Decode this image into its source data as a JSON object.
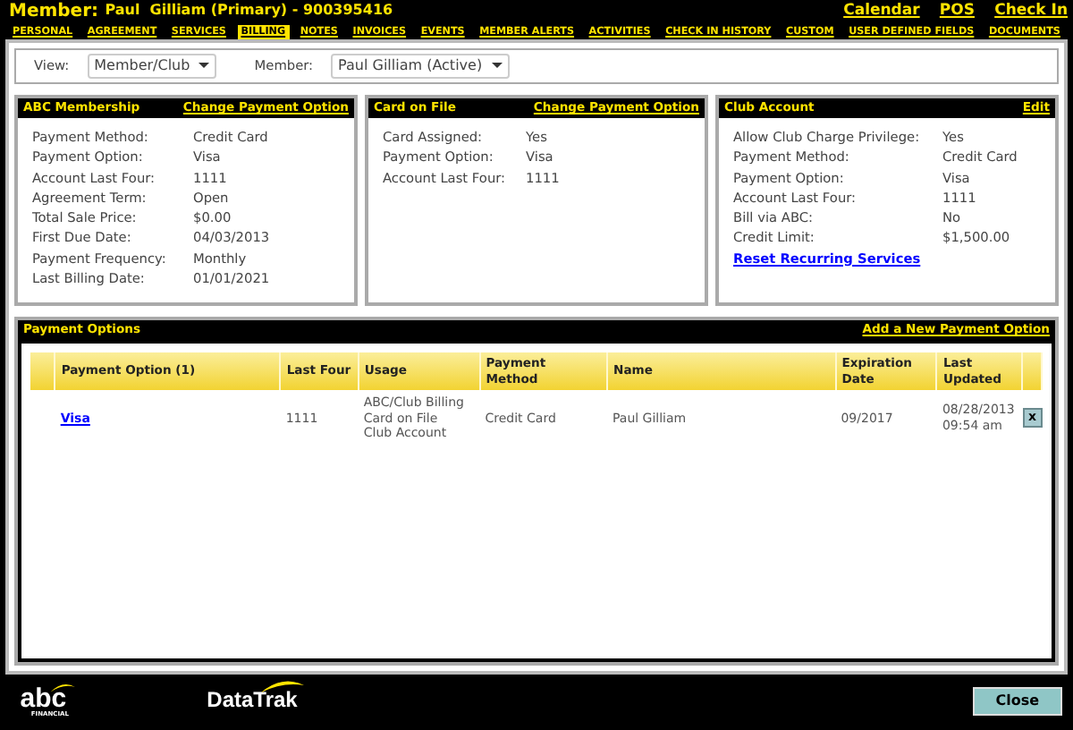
{
  "header": {
    "label": "Member:",
    "member": "Paul  Gilliam (Primary) - 900395416",
    "links": [
      "Calendar",
      "POS",
      "Check In"
    ]
  },
  "tabs": [
    {
      "label": "PERSONAL",
      "selected": false
    },
    {
      "label": "AGREEMENT",
      "selected": false
    },
    {
      "label": "SERVICES",
      "selected": false
    },
    {
      "label": "BILLING",
      "selected": true
    },
    {
      "label": "NOTES",
      "selected": false
    },
    {
      "label": "INVOICES",
      "selected": false
    },
    {
      "label": "EVENTS",
      "selected": false
    },
    {
      "label": "MEMBER ALERTS",
      "selected": false
    },
    {
      "label": "ACTIVITIES",
      "selected": false
    },
    {
      "label": "CHECK IN HISTORY",
      "selected": false
    },
    {
      "label": "CUSTOM",
      "selected": false
    },
    {
      "label": "USER DEFINED FIELDS",
      "selected": false
    },
    {
      "label": "DOCUMENTS",
      "selected": false
    }
  ],
  "filters": [
    {
      "label": "View:",
      "value": "Member/Club"
    },
    {
      "label": "Member:",
      "value": "Paul Gilliam (Active)"
    }
  ],
  "panels": [
    {
      "title": "ABC Membership",
      "action": "Change Payment Option",
      "rows": [
        [
          "Payment Method:",
          "Credit Card"
        ],
        [
          "Payment Option:",
          "Visa"
        ],
        [
          "Account Last Four:",
          "1111"
        ],
        [
          "Agreement Term:",
          "Open"
        ],
        [
          "Total Sale Price:",
          "$0.00"
        ],
        [
          "First Due Date:",
          "04/03/2013"
        ],
        [
          "Payment Frequency:",
          "Monthly"
        ],
        [
          "Last Billing Date:",
          "01/01/2021"
        ]
      ]
    },
    {
      "title": "Card on File",
      "action": "Change Payment Option",
      "rows": [
        [
          "Card Assigned:",
          "Yes"
        ],
        [
          "Payment Option:",
          "Visa"
        ],
        [
          "Account Last Four:",
          "1111"
        ]
      ]
    },
    {
      "title": "Club Account",
      "action": "Edit",
      "rows": [
        [
          "Allow Club Charge Privilege:",
          "Yes"
        ],
        [
          "Payment Method:",
          "Credit Card"
        ],
        [
          "Payment Option:",
          "Visa"
        ],
        [
          "Account Last Four:",
          "1111"
        ],
        [
          "Bill via ABC:",
          "No"
        ],
        [
          "Credit Limit:",
          "$1,500.00"
        ]
      ],
      "link": "Reset Recurring Services"
    }
  ],
  "payment_options": {
    "title": "Payment Options",
    "action": "Add a New Payment Option",
    "columns": [
      "Payment Option (1)",
      "Last Four",
      "Usage",
      "Payment Method",
      "Name",
      "Expiration Date",
      "Last Updated"
    ],
    "rows": [
      {
        "option": "Visa",
        "last_four": "1111",
        "usage": [
          "ABC/Club Billing",
          "Card on File",
          "Club Account"
        ],
        "method": "Credit Card",
        "name": "Paul Gilliam",
        "expiration": "09/2017",
        "updated": "08/28/2013 09:54 am",
        "delete": "x"
      }
    ]
  },
  "footer": {
    "abc_logo": "abc",
    "abc_sub": "FINANCIAL",
    "datatrak_logo": "DataTrak",
    "close": "Close"
  }
}
